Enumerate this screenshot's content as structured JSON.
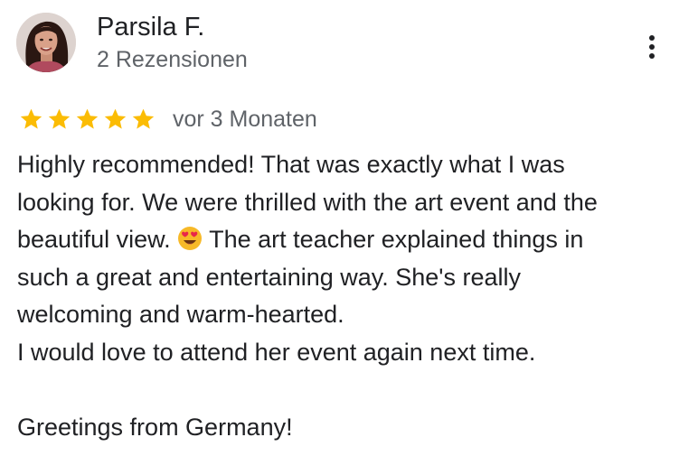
{
  "review": {
    "reviewer_name": "Parsila F.",
    "review_count": "2 Rezensionen",
    "rating": 5,
    "rating_max": 5,
    "time_ago": "vor 3 Monaten",
    "body": {
      "line1": "Highly recommended! That was exactly what I was",
      "line2": "looking for. We were thrilled with the art event and the",
      "line3_before_emoji": "beautiful view.",
      "line3_after_emoji": "The art teacher explained things in",
      "line4": "such a great and entertaining way. She's really",
      "line5": "welcoming and warm-hearted.",
      "line6": "I would love to attend her event again next time.",
      "line7": "Greetings from Germany!"
    },
    "icons": {
      "more": "more-vert-icon",
      "star": "star-icon",
      "emoji": "heart-eyes-emoji-icon"
    }
  },
  "colors": {
    "star": "#fbbc04",
    "text_primary": "#202124",
    "text_secondary": "#5f6368"
  }
}
